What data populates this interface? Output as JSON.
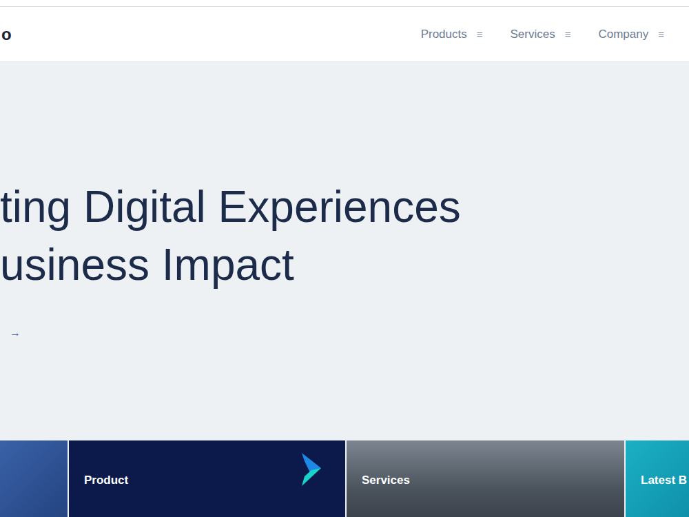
{
  "header": {
    "logo": "o",
    "nav": [
      {
        "label": "Products",
        "icon": "≡"
      },
      {
        "label": "Services",
        "icon": "≡"
      },
      {
        "label": "Company",
        "icon": "≡"
      }
    ]
  },
  "hero": {
    "lines": [
      "ting Digital Experiences",
      "usiness Impact"
    ],
    "arrow": "→"
  },
  "cards": [
    {
      "kind": "image",
      "label": ""
    },
    {
      "kind": "product",
      "label": "Product"
    },
    {
      "kind": "city",
      "label": "Services"
    },
    {
      "kind": "teal",
      "label": "Latest B"
    }
  ]
}
